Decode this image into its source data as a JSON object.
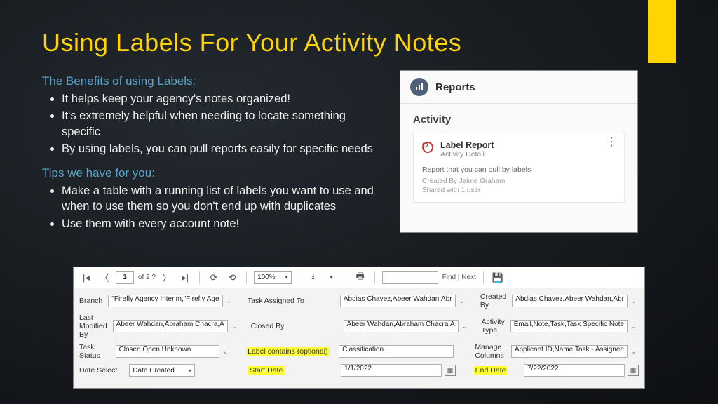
{
  "title": "Using Labels For Your Activity Notes",
  "benefits_heading": "The Benefits of using Labels:",
  "benefits": [
    "It helps keep your agency's notes organized!",
    "It's extremely helpful when needing to locate something specific",
    "By using labels, you can pull reports easily for specific needs"
  ],
  "tips_heading": "Tips we have for you:",
  "tips": [
    "Make a table with a running list of labels you want to use and when to use them so you don't end up with duplicates",
    "Use them with every account note!"
  ],
  "reports": {
    "header": "Reports",
    "activity": "Activity",
    "item": {
      "title": "Label Report",
      "subtitle": "Activity Detail",
      "desc": "Report that you can pull by labels",
      "created": "Created By Jaime Graham",
      "shared": "Shared with 1 user"
    }
  },
  "toolbar": {
    "page": "1",
    "of": "of 2 ?",
    "zoom": "100%",
    "find": "Find | Next"
  },
  "filters": {
    "branch_lbl": "Branch",
    "branch_val": "\"Firefly Agency Interim,\"Firefly Age",
    "task_assigned_lbl": "Task Assigned To",
    "task_assigned_val": "Abdias Chavez,Abeer Wahdan,Abr",
    "created_by_lbl": "Created By",
    "created_by_val": "Abdias Chavez,Abeer Wahdan,Abr",
    "last_mod_lbl": "Last Modified By",
    "last_mod_val": "Abeer Wahdan,Abraham Chacra,A",
    "closed_by_lbl": "Closed By",
    "closed_by_val": "Abeer Wahdan,Abraham Chacra,A",
    "activity_type_lbl": "Activity Type",
    "activity_type_val": "Email,Note,Task,Task Specific Note",
    "task_status_lbl": "Task Status",
    "task_status_val": "Closed,Open,Unknown",
    "label_contains_lbl": "Label contains (optional)",
    "label_contains_val": "Classification",
    "manage_cols_lbl": "Manage Columns",
    "manage_cols_val": "Applicant ID,Name,Task - Assignee",
    "date_select_lbl": "Date Select",
    "date_select_val": "Date Created",
    "start_date_lbl": "Start Date",
    "start_date_val": "1/1/2022",
    "end_date_lbl": "End Date",
    "end_date_val": "7/22/2022"
  }
}
